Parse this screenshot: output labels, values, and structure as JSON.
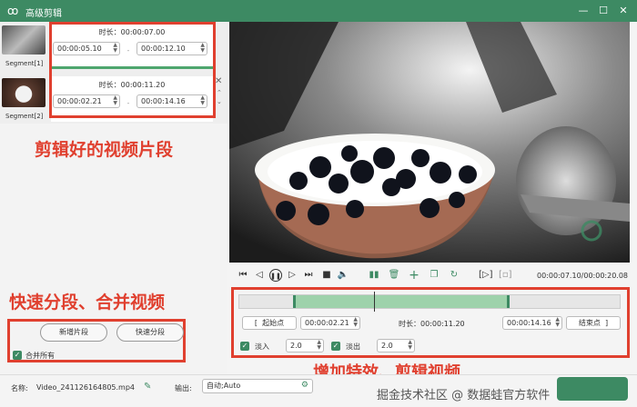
{
  "window": {
    "title": "高级剪辑"
  },
  "segments": [
    {
      "label": "Segment[1]",
      "duration": "时长：00:00:07.00",
      "start": "00:00:05.10",
      "end": "00:00:12.10"
    },
    {
      "label": "Segment[2]",
      "duration": "时长：00:00:11.20",
      "start": "00:00:02.21",
      "end": "00:00:14.16"
    }
  ],
  "annotations": {
    "segments_note": "剪辑好的视频片段",
    "quick_note": "快速分段、合并视频",
    "effects_note": "增加特效、剪辑视频"
  },
  "left_controls": {
    "add_segment": "新增片段",
    "quick_segment": "快速分段",
    "merge_all": "合并所有"
  },
  "player": {
    "time_display": "00:00:07.10/00:00:20.08"
  },
  "edit": {
    "start_label": "起始点",
    "start_value": "00:00:02.21",
    "duration": "时长：00:00:11.20",
    "end_value": "00:00:14.16",
    "end_label": "结束点",
    "fade_in_label": "淡入",
    "fade_in_value": "2.0",
    "fade_out_label": "淡出",
    "fade_out_value": "2.0",
    "selection_start_fraction": 0.14,
    "selection_end_fraction": 0.71,
    "playhead_fraction": 0.355
  },
  "bottom": {
    "name_label": "名称:",
    "name_value": "Video_241126164805.mp4",
    "output_label": "输出:",
    "output_value": "自动;Auto"
  },
  "watermark": "掘金技术社区 @ 数据蛙官方软件",
  "colors": {
    "accent": "#3d8a63",
    "annotation": "#e0402f"
  }
}
